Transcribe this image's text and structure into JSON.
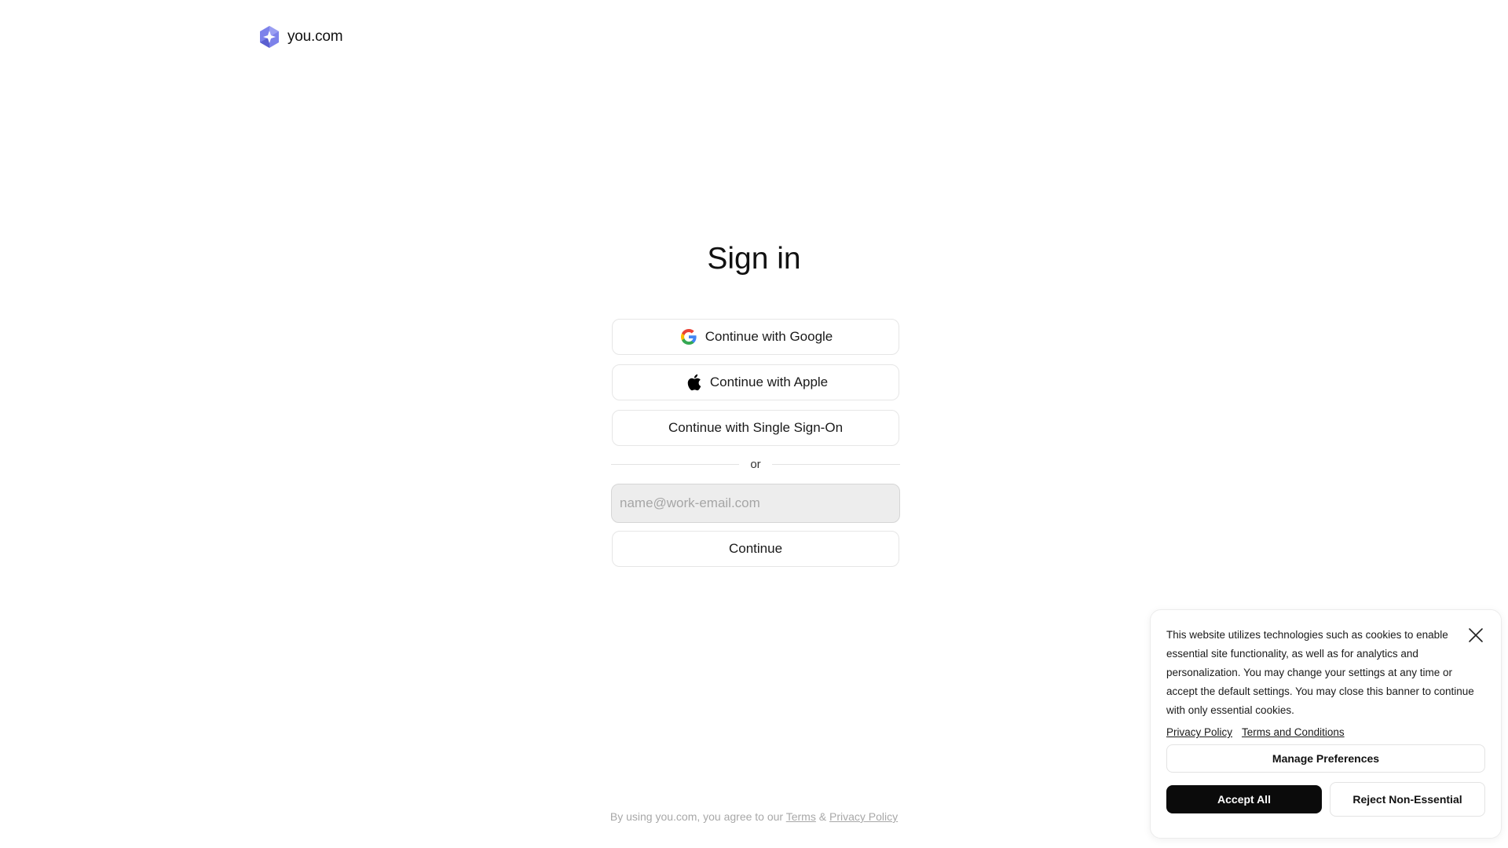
{
  "brand": {
    "name": "you.com",
    "logo_color": "#6b6fe0"
  },
  "signin": {
    "title": "Sign in",
    "google_label": "Continue with Google",
    "apple_label": "Continue with Apple",
    "sso_label": "Continue with Single Sign-On",
    "divider_label": "or",
    "email_placeholder": "name@work-email.com",
    "email_value": "",
    "continue_label": "Continue"
  },
  "legal": {
    "prefix": "By using you.com, you agree to our",
    "terms_label": "Terms",
    "ampersand": "&",
    "privacy_label": "Privacy Policy"
  },
  "cookie_banner": {
    "text": "This website utilizes technologies such as cookies to enable essential site functionality, as well as for analytics and personalization. You may change your settings at any time or accept the default settings. You may close this banner to continue with only essential cookies.",
    "privacy_link": "Privacy Policy",
    "terms_link": "Terms and Conditions",
    "manage_label": "Manage Preferences",
    "accept_label": "Accept All",
    "reject_label": "Reject Non-Essential",
    "close_icon": "close-icon"
  },
  "icons": {
    "google": "google-icon",
    "apple": "apple-icon"
  }
}
